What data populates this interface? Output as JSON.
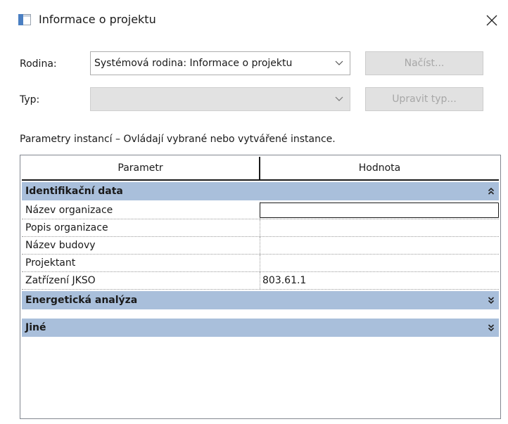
{
  "window": {
    "title": "Informace o projektu",
    "icon": "window-icon",
    "close_icon": "close-icon"
  },
  "form": {
    "family": {
      "label": "Rodina:",
      "value": "Systémová rodina: Informace o projektu",
      "load_button": "Načíst..."
    },
    "type": {
      "label": "Typ:",
      "value": "",
      "edit_type_button": "Upravit typ..."
    }
  },
  "instance_description": "Parametry instancí – Ovládají vybrané nebo vytvářené instance.",
  "grid": {
    "columns": [
      "Parametr",
      "Hodnota"
    ],
    "groups": [
      {
        "title": "Identifikační data",
        "expanded": true,
        "rows": [
          {
            "param": "Název organizace",
            "value": ""
          },
          {
            "param": "Popis organizace",
            "value": ""
          },
          {
            "param": "Název budovy",
            "value": ""
          },
          {
            "param": "Projektant",
            "value": ""
          },
          {
            "param": "Zatřízení JKSO",
            "value": "803.61.1"
          }
        ]
      },
      {
        "title": "Energetická analýza",
        "expanded": false
      },
      {
        "title": "Jiné",
        "expanded": false
      }
    ]
  },
  "colors": {
    "group_header": "#a9bfdb",
    "disabled_button": "#e1e1e1",
    "disabled_text": "#a7a7a7"
  }
}
